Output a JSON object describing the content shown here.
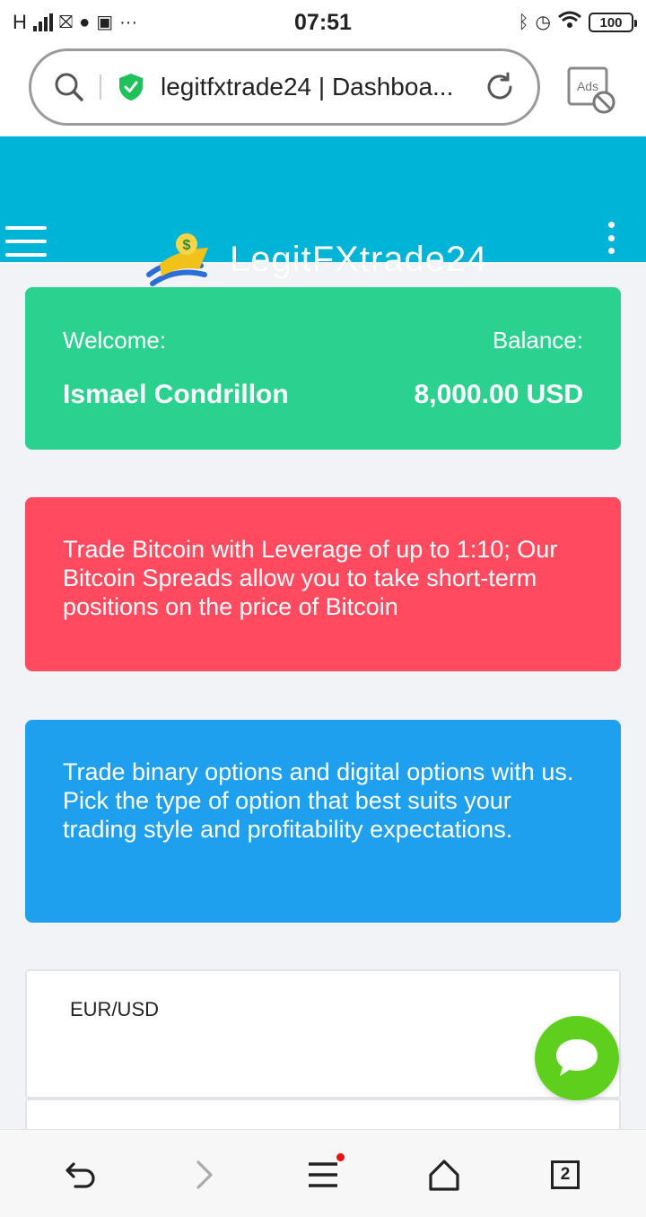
{
  "status_bar": {
    "network": "H",
    "time": "07:51",
    "battery": "100"
  },
  "browser": {
    "url_title": "legitfxtrade24 | Dashboa...",
    "ads_label": "Ads",
    "tab_count": "2"
  },
  "site": {
    "brand": "LegitFXtrade24"
  },
  "welcome_card": {
    "welcome_label": "Welcome:",
    "user_name": "Ismael Condrillon",
    "balance_label": "Balance:",
    "balance_value": "8,000.00 USD"
  },
  "promos": [
    {
      "text": "Trade Bitcoin with Leverage of up to 1:10; Our Bitcoin Spreads allow you to take short-term positions on the price of Bitcoin"
    },
    {
      "text": "Trade binary options and digital options with us. Pick the type of option that best suits your trading style and profitability expectations."
    }
  ],
  "widget": {
    "pair": "EUR/USD"
  },
  "colors": {
    "header": "#00b4d8",
    "welcome": "#2bd18f",
    "promo_red": "#ff4a5f",
    "promo_blue": "#1fa0ef",
    "chat": "#5fcf1e"
  },
  "icons": {
    "search": "search-icon",
    "secure": "shield-check-icon",
    "reload": "reload-icon",
    "ads_block": "ads-block-icon",
    "menu": "hamburger-menu-icon",
    "more": "more-vertical-icon",
    "chat": "chat-bubble-icon",
    "back": "back-icon",
    "forward": "forward-icon",
    "browser_menu": "menu-icon",
    "home": "home-icon",
    "tabs": "tabs-icon"
  }
}
